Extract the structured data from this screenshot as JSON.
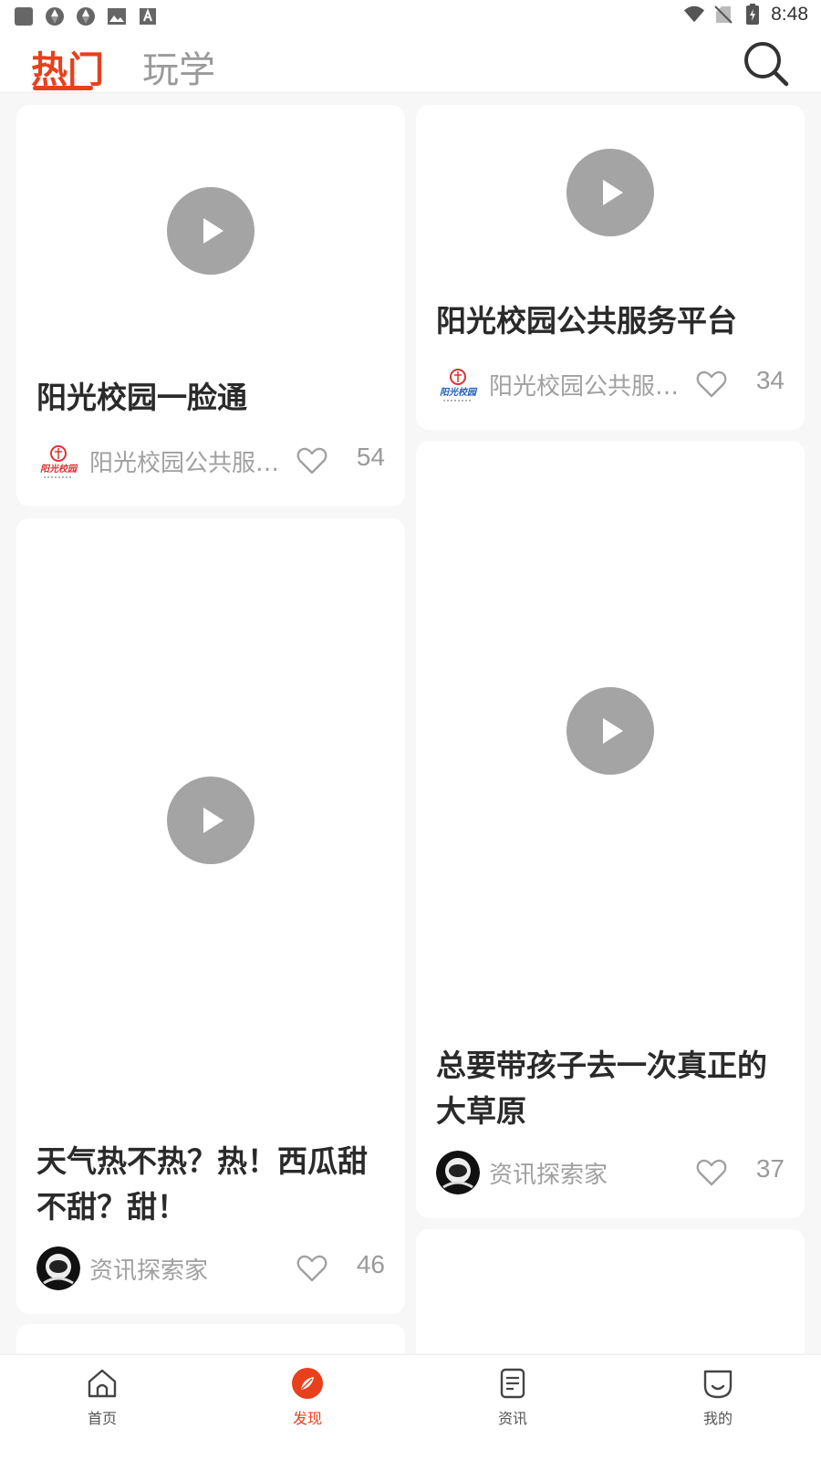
{
  "status_bar": {
    "time": "8:48",
    "left_icons": [
      "app-square-icon",
      "aperture-icon",
      "aperture-icon",
      "image-icon",
      "font-a-icon"
    ],
    "right_icons": [
      "wifi-icon",
      "no-sim-icon",
      "battery-charging-icon"
    ]
  },
  "header": {
    "tabs": [
      {
        "label": "热门",
        "active": true
      },
      {
        "label": "玩学",
        "active": false
      }
    ],
    "search_icon": "search-icon"
  },
  "feed": {
    "cards": [
      {
        "title": "阳光校园一脸通",
        "author": "阳光校园公共服…",
        "likes": "54",
        "avatar": "sunshine-campus-logo"
      },
      {
        "title": "阳光校园公共服务平台",
        "author": "阳光校园公共服…",
        "likes": "34",
        "avatar": "sunshine-campus-logo"
      },
      {
        "title": "天气热不热？热！西瓜甜不甜？甜！",
        "author": "资讯探索家",
        "likes": "46",
        "avatar": "astronaut-avatar"
      },
      {
        "title": "总要带孩子去一次真正的大草原",
        "author": "资讯探索家",
        "likes": "37",
        "avatar": "astronaut-avatar"
      }
    ]
  },
  "bottom_nav": {
    "items": [
      {
        "label": "首页",
        "icon": "home-icon",
        "active": false
      },
      {
        "label": "发现",
        "icon": "compass-icon",
        "active": true
      },
      {
        "label": "资讯",
        "icon": "document-icon",
        "active": false
      },
      {
        "label": "我的",
        "icon": "smile-icon",
        "active": false
      }
    ]
  },
  "colors": {
    "accent": "#e8401c",
    "play_button": "#a4a4a4",
    "background": "#f7f7f7",
    "muted_text": "#9a9a9a"
  }
}
